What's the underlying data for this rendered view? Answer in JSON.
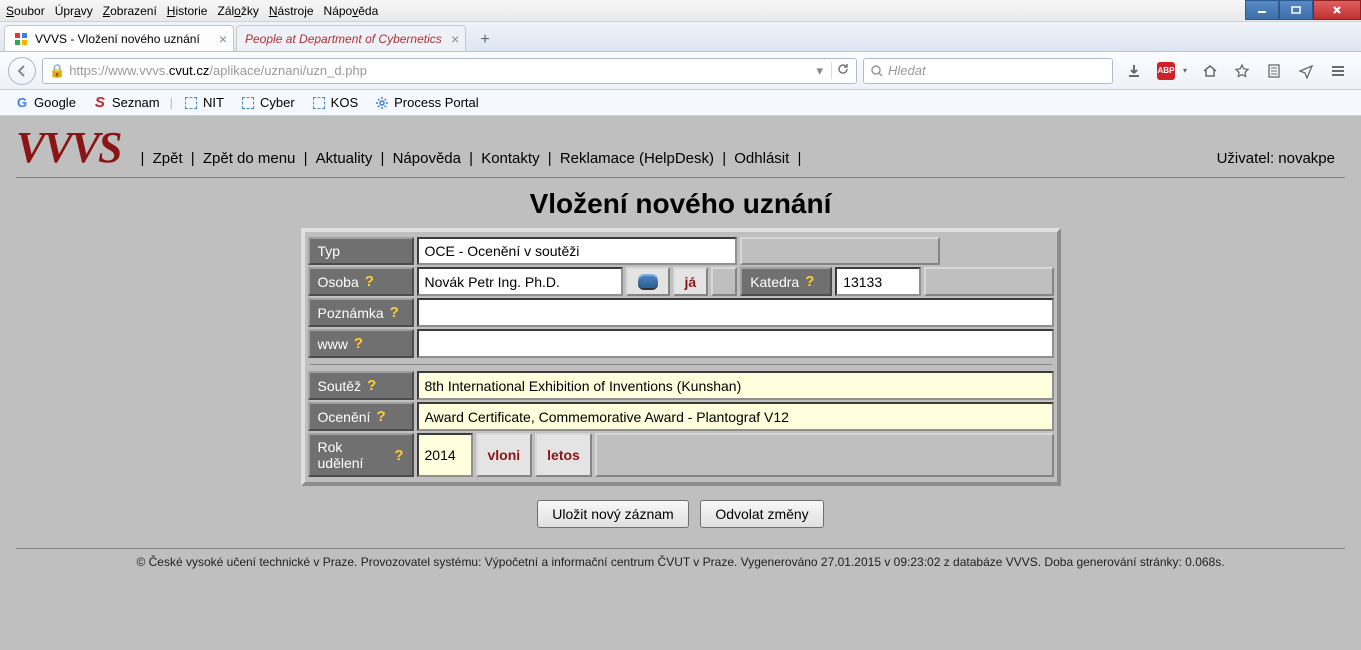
{
  "menubar": [
    "Soubor",
    "Úpravy",
    "Zobrazení",
    "Historie",
    "Záložky",
    "Nástroje",
    "Nápověda"
  ],
  "tabs": {
    "active": "VVVS - Vložení nového uznání",
    "inactive": "People at Department of Cybernetics"
  },
  "url": {
    "proto": "https://",
    "host_pre": "www.vvvs.",
    "host_bold": "cvut.cz",
    "path": "/aplikace/uznani/uzn_d.php"
  },
  "search": {
    "placeholder": "Hledat"
  },
  "bookmarks": {
    "google": "Google",
    "seznam": "Seznam",
    "nit": "NIT",
    "cyber": "Cyber",
    "kos": "KOS",
    "portal": "Process Portal"
  },
  "app": {
    "logo": "VVVS",
    "nav": {
      "zpet": "Zpět",
      "zpet_menu": "Zpět do menu",
      "aktuality": "Aktuality",
      "napoveda": "Nápověda",
      "kontakty": "Kontakty",
      "reklamace": "Reklamace (HelpDesk)",
      "odhlasit": "Odhlásit"
    },
    "user_label": "Uživatel: ",
    "user": "novakpe",
    "title": "Vložení nového uznání",
    "fields": {
      "typ_lbl": "Typ",
      "typ_val": "OCE - Ocenění v soutěži",
      "osoba_lbl": "Osoba",
      "osoba_val": "Novák Petr Ing. Ph.D.",
      "ja_btn": "já",
      "katedra_lbl": "Katedra",
      "katedra_val": "13133",
      "poznamka_lbl": "Poznámka",
      "poznamka_val": "",
      "www_lbl": "www",
      "www_val": "",
      "soutez_lbl": "Soutěž",
      "soutez_val": "8th International Exhibition of Inventions (Kunshan)",
      "oceneni_lbl": "Ocenění",
      "oceneni_val": "Award Certificate, Commemorative Award - Plantograf V12",
      "rok_lbl": "Rok udělení",
      "rok_val": "2014",
      "vloni_btn": "vloni",
      "letos_btn": "letos"
    },
    "actions": {
      "save": "Uložit nový záznam",
      "cancel": "Odvolat změny"
    },
    "footer": "© České vysoké učení technické v Praze. Provozovatel systému: Výpočetní a informační centrum ČVUT v Praze. Vygenerováno 27.01.2015 v 09:23:02 z databáze VVVS. Doba generování stránky: 0.068s."
  }
}
